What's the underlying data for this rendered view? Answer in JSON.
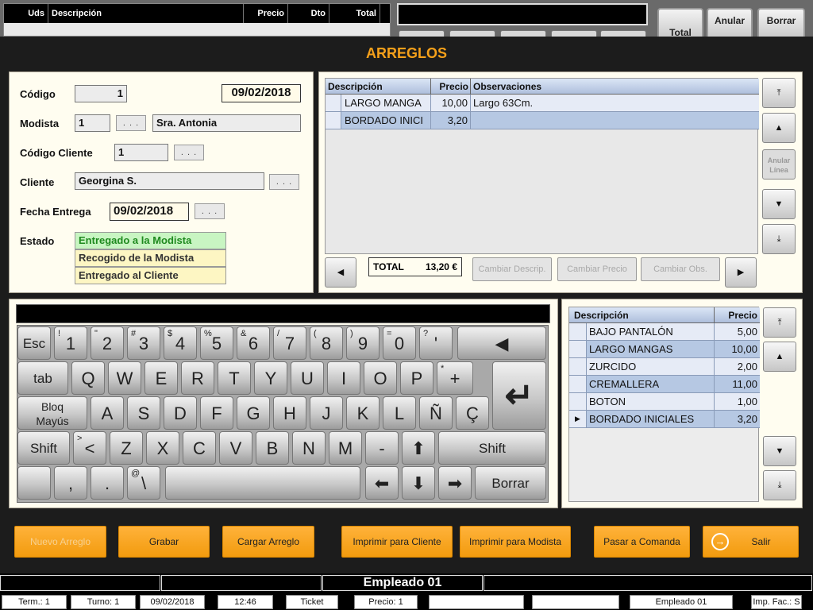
{
  "background": {
    "columns": [
      "Uds",
      "Descripción",
      "Precio",
      "Dto",
      "Total"
    ],
    "buttons": [
      "Total",
      "Anular",
      "Borrar"
    ]
  },
  "title": "ARREGLOS",
  "form": {
    "codigo_label": "Código",
    "codigo_value": "1",
    "fecha_value": "09/02/2018",
    "modista_label": "Modista",
    "modista_id": "1",
    "modista_name": "Sra. Antonia",
    "codigo_cliente_label": "Código Cliente",
    "codigo_cliente_value": "1",
    "cliente_label": "Cliente",
    "cliente_value": "Georgina S.",
    "fecha_entrega_label": "Fecha Entrega",
    "fecha_entrega_value": "09/02/2018",
    "estado_label": "Estado",
    "estado_options": [
      "Entregado a la Modista",
      "Recogido de la Modista",
      "Entregado al Cliente"
    ],
    "dots": ". . ."
  },
  "lines": {
    "columns": [
      "Descripción",
      "Precio",
      "Observaciones"
    ],
    "rows": [
      {
        "desc": "LARGO MANGA",
        "precio": "10,00",
        "obs": "Largo 63Cm."
      },
      {
        "desc": "BORDADO INICI",
        "precio": "3,20",
        "obs": ""
      }
    ],
    "total_label": "TOTAL",
    "total_value": "13,20 €",
    "buttons": [
      "Cambiar Descrip.",
      "Cambiar Precio",
      "Cambiar Obs."
    ],
    "anular_linea": "Anular Línea"
  },
  "keyboard": {
    "row1": [
      "Esc",
      "1",
      "2",
      "3",
      "4",
      "5",
      "6",
      "7",
      "8",
      "9",
      "0",
      "'"
    ],
    "row1_sub": [
      "",
      "!",
      "\"",
      "#",
      "$",
      "%",
      "&",
      "/",
      "(",
      ")",
      "=",
      "?"
    ],
    "row2": [
      "tab",
      "Q",
      "W",
      "E",
      "R",
      "T",
      "Y",
      "U",
      "I",
      "O",
      "P",
      "+"
    ],
    "row3_caps": [
      "Bloq",
      "Mayús"
    ],
    "row3": [
      "A",
      "S",
      "D",
      "F",
      "G",
      "H",
      "J",
      "K",
      "L",
      "Ñ",
      "Ç"
    ],
    "row4": [
      "Shift",
      "<",
      "Z",
      "X",
      "C",
      "V",
      "B",
      "N",
      "M",
      "-",
      "Shift"
    ],
    "row5": [
      ",",
      ".",
      "\\",
      "Borrar"
    ],
    "row5_sub": [
      "",
      "",
      "@",
      ""
    ],
    "plus_sub": "*",
    "lt_sub": ">"
  },
  "catalog": {
    "columns": [
      "Descripción",
      "Precio"
    ],
    "rows": [
      {
        "desc": "BAJO PANTALÓN",
        "precio": "5,00"
      },
      {
        "desc": "LARGO MANGAS",
        "precio": "10,00"
      },
      {
        "desc": "ZURCIDO",
        "precio": "2,00"
      },
      {
        "desc": "CREMALLERA",
        "precio": "11,00"
      },
      {
        "desc": "BOTON",
        "precio": "1,00"
      },
      {
        "desc": "BORDADO INICIALES",
        "precio": "3,20"
      }
    ]
  },
  "actions": [
    "Nuevo Arreglo",
    "Grabar",
    "Cargar Arreglo",
    "Imprimir para Cliente",
    "Imprimir para Modista",
    "Pasar a Comanda",
    "Salir"
  ],
  "employee": "Empleado 01",
  "status": {
    "term": "Term.: 1",
    "turno": "Turno: 1",
    "date": "09/02/2018",
    "time": "12:46",
    "doc": "Ticket",
    "precio": "Precio: 1",
    "empleado": "Empleado 01",
    "imp": "Imp. Fac.: S"
  },
  "colors": {
    "accent": "#f5a01a",
    "estado_selected": "#c8f5c2",
    "estado_other": "#fdf6c3"
  }
}
